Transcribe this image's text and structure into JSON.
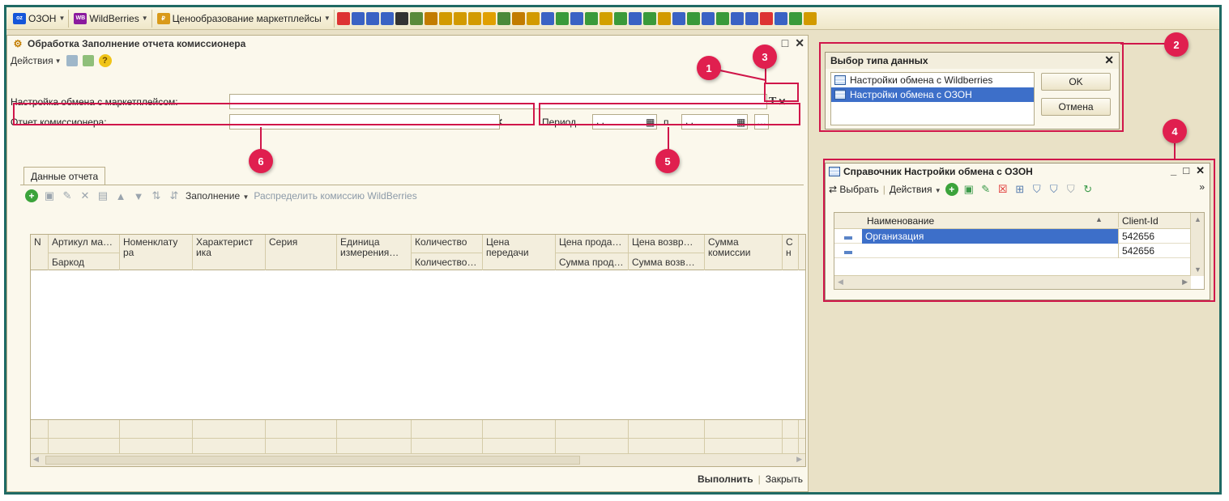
{
  "toolbar": {
    "menus": [
      {
        "label": "ОЗОН",
        "logo": "ozon"
      },
      {
        "label": "WildBerries",
        "logo": "WB"
      },
      {
        "label": "Ценообразование маркетплейсы",
        "logo": "price"
      }
    ]
  },
  "main_window": {
    "title": "Обработка  Заполнение отчета комиссионера",
    "actions_label": "Действия",
    "exchange_label": "Настройка обмена с маркетплейсом:",
    "exchange_value": "",
    "report_label": "Отчет комиссионера:",
    "report_value": "",
    "period_label": "Период…",
    "period_from": ". .",
    "period_to_label": "п…",
    "period_to": ". .",
    "tab_label": "Данные отчета",
    "grid_toolbar": {
      "fill_label": "Заполнение",
      "distribute_label": "Распределить комиссию WildBerries"
    },
    "grid_columns": [
      {
        "top": "N",
        "bottom": ""
      },
      {
        "top": "Артикул ма…",
        "bottom": "Баркод"
      },
      {
        "top": "Номенклату ра",
        "bottom": ""
      },
      {
        "top": "Характерист ика",
        "bottom": ""
      },
      {
        "top": "Серия",
        "bottom": ""
      },
      {
        "top": "Единица измерения…",
        "bottom": ""
      },
      {
        "top": "Количество",
        "bottom": "Количество…"
      },
      {
        "top": "Цена передачи",
        "bottom": ""
      },
      {
        "top": "Цена прода…",
        "bottom": "Сумма прод…"
      },
      {
        "top": "Цена возвр…",
        "bottom": "Сумма возв…"
      },
      {
        "top": "Сумма комиссии",
        "bottom": ""
      },
      {
        "top": "С н",
        "bottom": ""
      }
    ],
    "run_label": "Выполнить",
    "close_label": "Закрыть"
  },
  "dialog": {
    "title": "Выбор типа данных",
    "items": [
      {
        "label": "Настройки обмена с Wildberries",
        "selected": false
      },
      {
        "label": "Настройки обмена с ОЗОН",
        "selected": true
      }
    ],
    "ok_label": "OK",
    "cancel_label": "Отмена"
  },
  "catalog": {
    "title": "Справочник Настройки обмена с ОЗОН",
    "select_label": "Выбрать",
    "actions_label": "Действия",
    "col_name": "Наименование",
    "col_client": "Client-Id",
    "rows": [
      {
        "name": "Организация",
        "client_id": "542656",
        "selected": true
      },
      {
        "name": "",
        "client_id": "542656",
        "selected": false
      }
    ]
  },
  "callouts": [
    "1",
    "2",
    "3",
    "4",
    "5",
    "6"
  ],
  "colors": {
    "accent": "#e01f4f",
    "frame": "#1f6a64",
    "selection": "#3d6fc9"
  }
}
